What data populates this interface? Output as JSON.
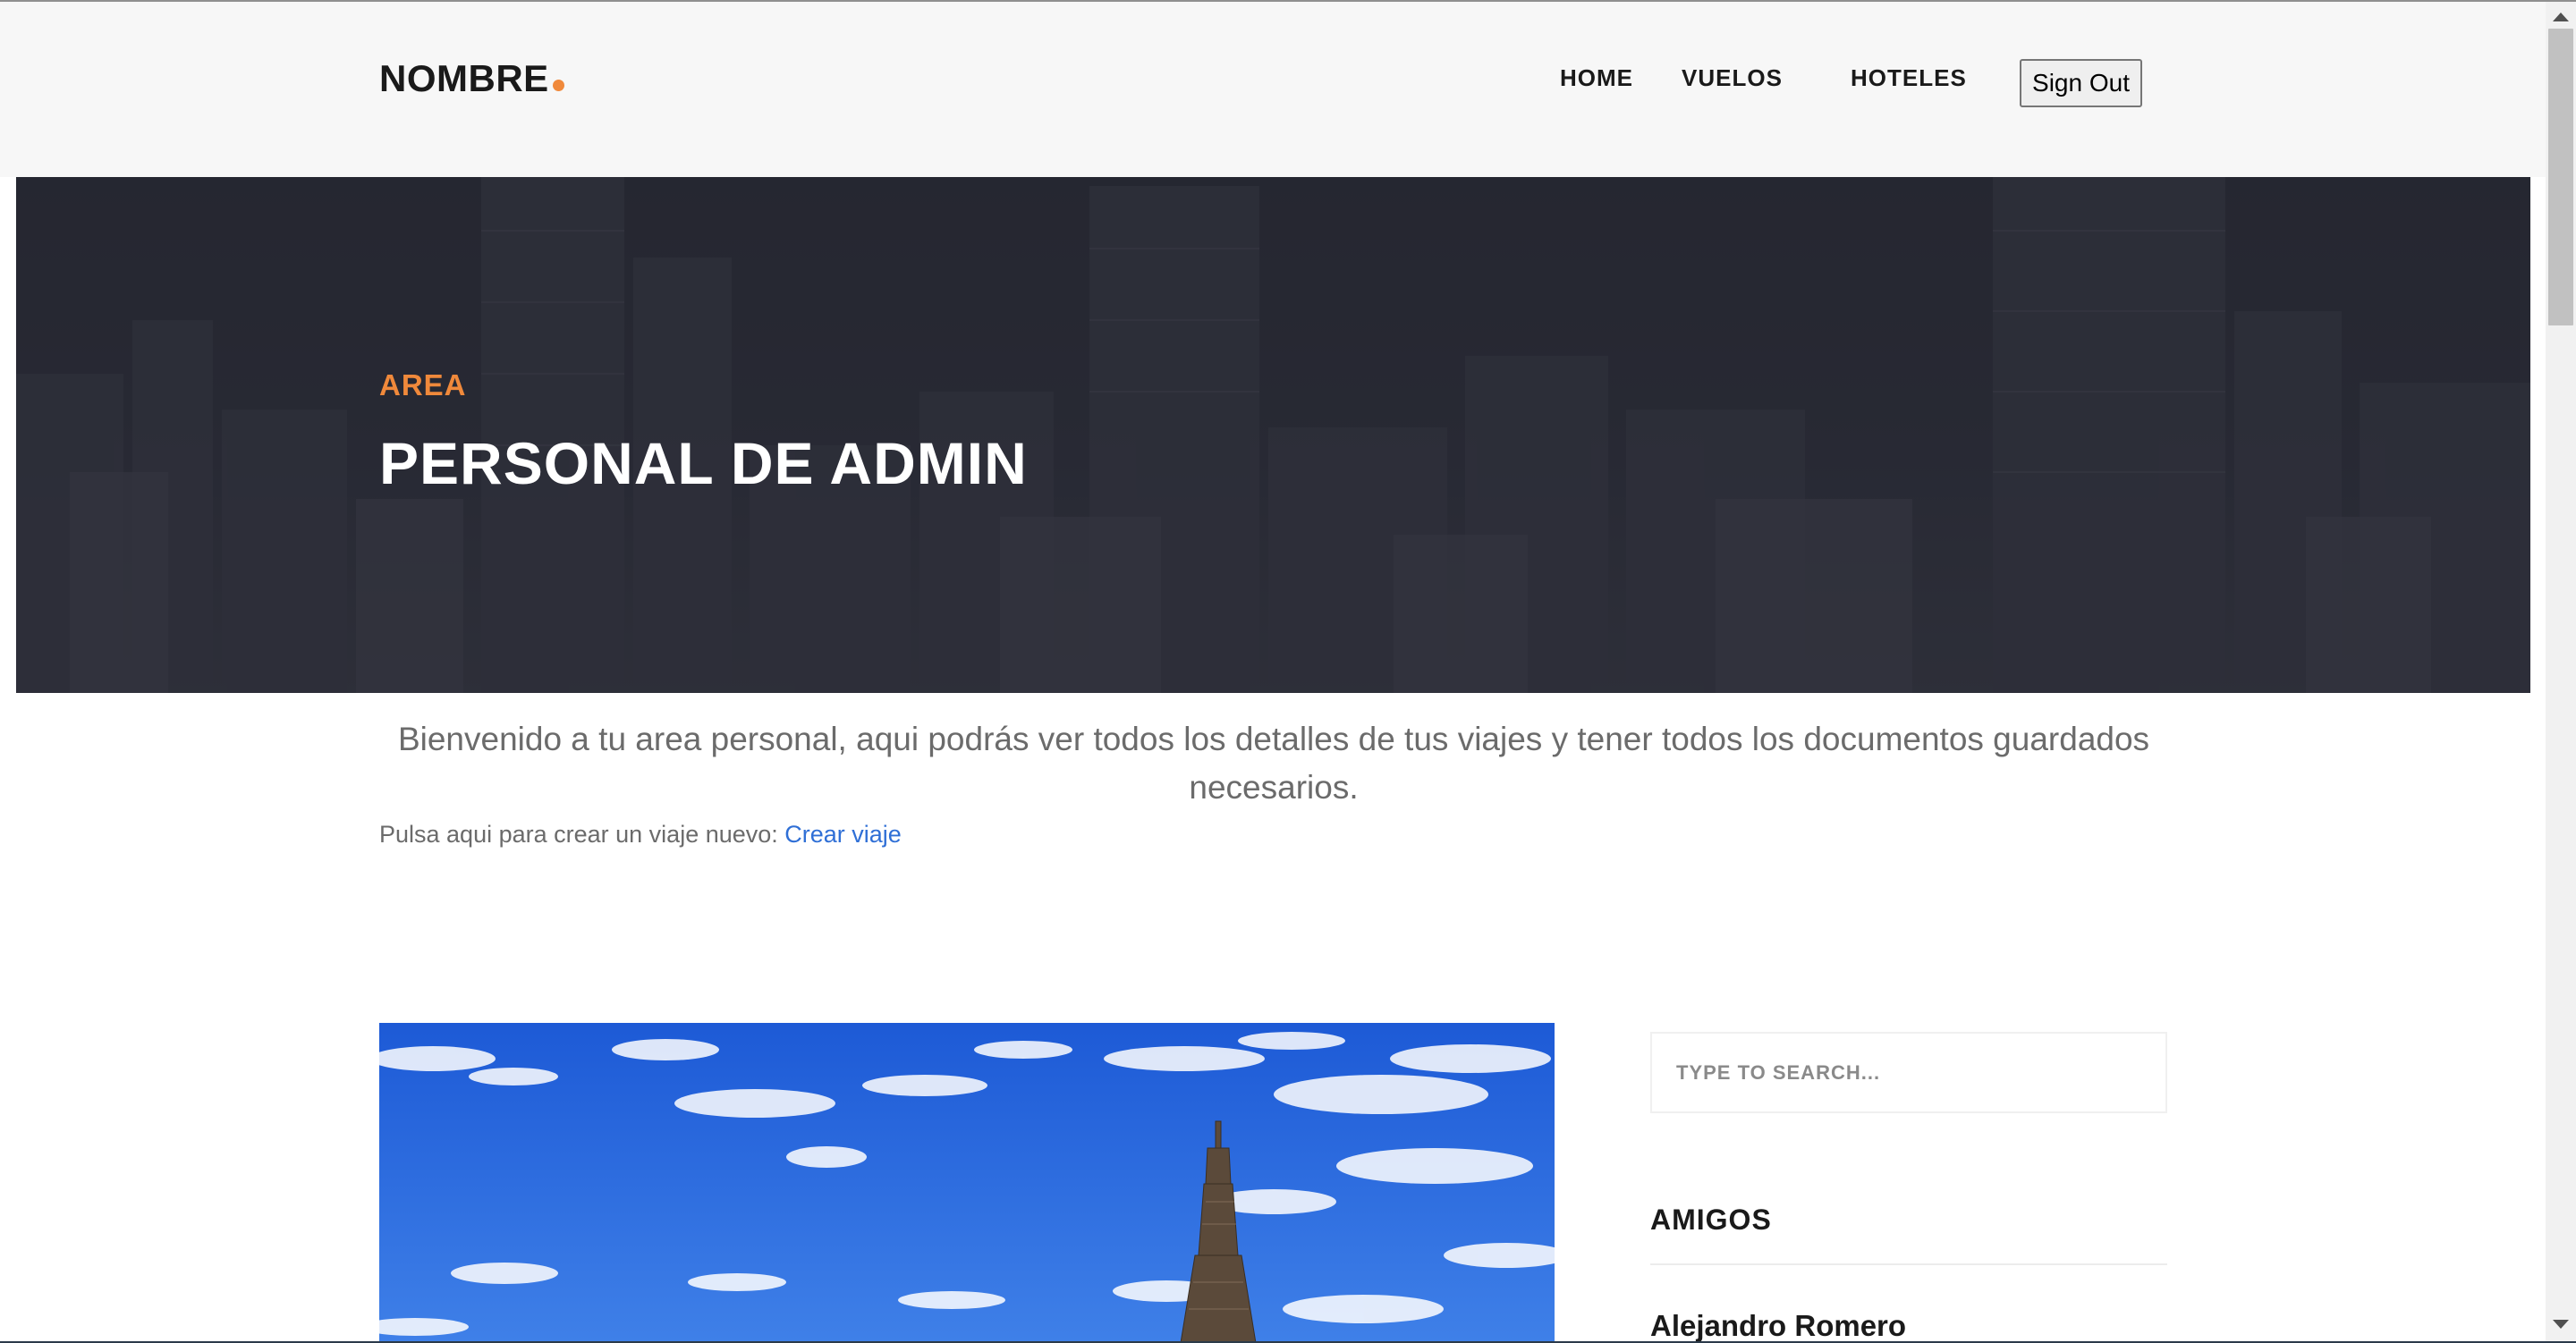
{
  "header": {
    "logo_text": "NOMBRE",
    "logo_accent_color": "#f0893b",
    "nav": {
      "home": "HOME",
      "vuelos": "VUELOS",
      "hoteles": "HOTELES"
    },
    "signout_label": "Sign Out"
  },
  "hero": {
    "kicker": "AREA",
    "title": "PERSONAL DE ADMIN",
    "kicker_color": "#f0893b"
  },
  "welcome": {
    "line1": "Bienvenido a tu area personal, aqui podrás ver todos los detalles de tus viajes y tener todos los documentos guardados",
    "line2": "necesarios.",
    "create_prompt": "Pulsa aqui para crear un viaje nuevo: ",
    "create_link": "Crear viaje"
  },
  "sidebar": {
    "search_placeholder": "TYPE TO SEARCH...",
    "friends_heading": "AMIGOS",
    "friends": [
      "Alejandro Romero"
    ]
  },
  "icons": {
    "trip_image": "eiffel-tower-image",
    "hero_background": "city-skyline-image"
  }
}
